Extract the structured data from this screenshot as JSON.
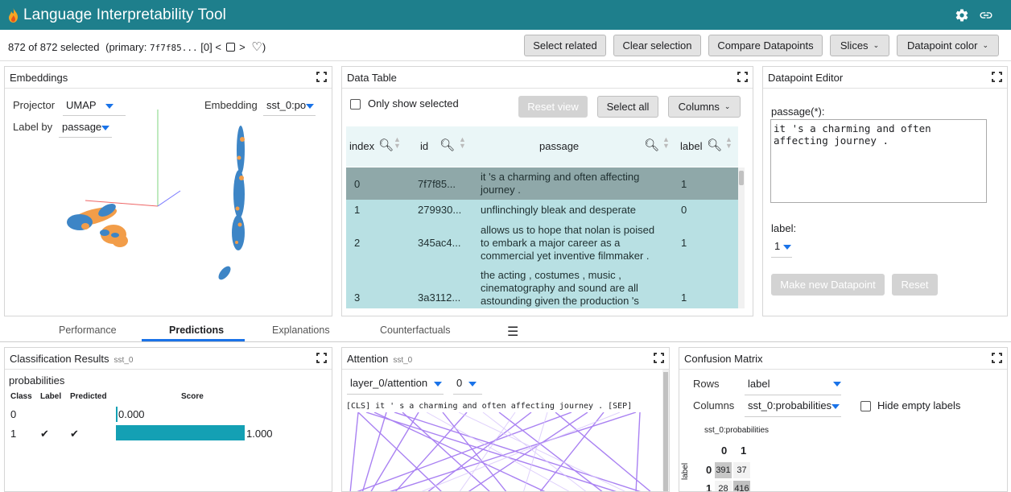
{
  "app": {
    "title": "Language Interpretability Tool",
    "icons": [
      "flame-icon",
      "settings-gear-icon",
      "link-icon"
    ]
  },
  "selection": {
    "count_text": "872 of 872 selected",
    "primary_prefix": "(primary: ",
    "primary_id": "7f7f85...",
    "primary_index": "[0]"
  },
  "header_buttons": {
    "select_related": "Select related",
    "clear_selection": "Clear selection",
    "compare": "Compare Datapoints",
    "slices": "Slices",
    "datapoint_color": "Datapoint color"
  },
  "embeddings": {
    "title": "Embeddings",
    "projector_label": "Projector",
    "projector_value": "UMAP",
    "embedding_label": "Embedding",
    "embedding_value": "sst_0:po",
    "labelby_label": "Label by",
    "labelby_value": "passage",
    "colors": {
      "orange": "#f29d49",
      "blue": "#3d85c6"
    }
  },
  "data_table": {
    "title": "Data Table",
    "only_show_selected": "Only show selected",
    "reset_view": "Reset view",
    "select_all": "Select all",
    "columns": "Columns",
    "headers": {
      "index": "index",
      "id": "id",
      "passage": "passage",
      "label": "label"
    },
    "rows": [
      {
        "index": "0",
        "id": "7f7f85...",
        "passage1": "it 's a charming and often affecting",
        "passage2": "journey .",
        "passage3": "",
        "label": "1"
      },
      {
        "index": "1",
        "id": "279930...",
        "passage1": "unflinchingly bleak and desperate",
        "passage2": "",
        "passage3": "",
        "label": "0"
      },
      {
        "index": "2",
        "id": "345ac4...",
        "passage1": "allows us to hope that nolan is poised",
        "passage2": "to embark a major career as a",
        "passage3": "commercial yet inventive filmmaker .",
        "label": "1"
      },
      {
        "index": "3",
        "id": "3a3112...",
        "passage1": "the acting , costumes , music ,",
        "passage2": "cinematography and sound are all",
        "passage3": "astounding given the production 's",
        "label": "1"
      }
    ]
  },
  "editor": {
    "title": "Datapoint Editor",
    "passage_label": "passage(*):",
    "passage_value": "it 's a charming and often affecting journey .",
    "label_label": "label:",
    "label_value": "1",
    "make_new": "Make new Datapoint",
    "reset": "Reset"
  },
  "tabs": [
    "Performance",
    "Predictions",
    "Explanations",
    "Counterfactuals"
  ],
  "active_tab": "Predictions",
  "classification": {
    "title": "Classification Results",
    "model": "sst_0",
    "heading": "probabilities",
    "cols": [
      "Class",
      "Label",
      "Predicted",
      "Score"
    ],
    "rows": [
      {
        "class": "0",
        "label": "",
        "predicted": "",
        "score": 0.0,
        "score_text": "0.000"
      },
      {
        "class": "1",
        "label": "✔",
        "predicted": "✔",
        "score": 1.0,
        "score_text": "1.000"
      }
    ]
  },
  "attention": {
    "title": "Attention",
    "model": "sst_0",
    "layer": "layer_0/attention",
    "head": "0",
    "tokens": "[CLS] it ' s a charming and often affecting journey . [SEP]"
  },
  "confusion": {
    "title": "Confusion Matrix",
    "rows_label": "Rows",
    "rows_value": "label",
    "columns_label": "Columns",
    "columns_value": "sst_0:probabilities",
    "hide_empty": "Hide empty labels",
    "axis_title": "sst_0:probabilities",
    "row_axis": "label",
    "col_headers": [
      "0",
      "1"
    ],
    "row_headers": [
      "0",
      "1"
    ],
    "cells": [
      [
        "391",
        "37"
      ],
      [
        "28",
        "416"
      ]
    ]
  }
}
